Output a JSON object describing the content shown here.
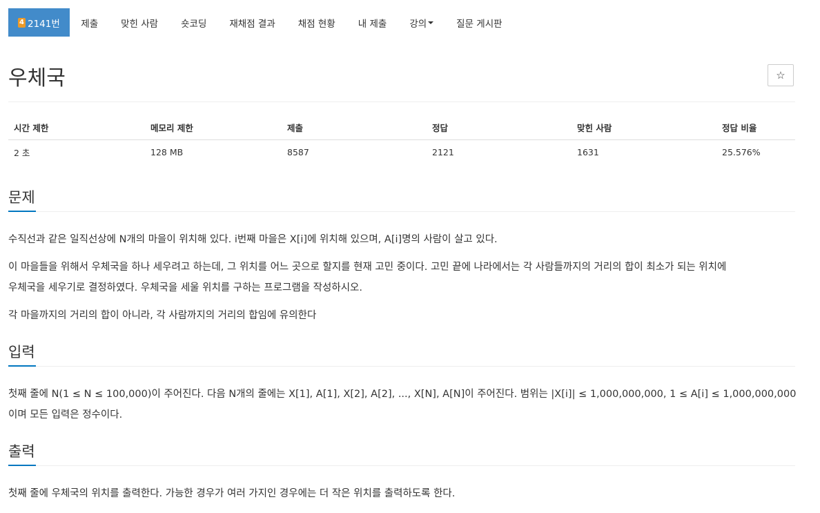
{
  "nav": {
    "problem_number": "2141번",
    "tier_badge": "4",
    "items": [
      {
        "label": "제출"
      },
      {
        "label": "맞힌 사람"
      },
      {
        "label": "숏코딩"
      },
      {
        "label": "재채점 결과"
      },
      {
        "label": "채점 현황"
      },
      {
        "label": "내 제출"
      },
      {
        "label": "강의"
      },
      {
        "label": "질문 게시판"
      }
    ]
  },
  "problem": {
    "title": "우체국",
    "star_icon": "☆"
  },
  "info_table": {
    "headers": [
      "시간 제한",
      "메모리 제한",
      "제출",
      "정답",
      "맞힌 사람",
      "정답 비율"
    ],
    "values": [
      "2 초",
      "128 MB",
      "8587",
      "2121",
      "1631",
      "25.576%"
    ]
  },
  "sections": {
    "problem_title": "문제",
    "problem_lines": [
      "수직선과 같은 일직선상에 N개의 마을이 위치해 있다. i번째 마을은 X[i]에 위치해 있으며, A[i]명의 사람이 살고 있다.",
      "이 마을들을 위해서 우체국을 하나 세우려고 하는데, 그 위치를 어느 곳으로 할지를 현재 고민 중이다. 고민 끝에 나라에서는 각 사람들까지의 거리의 합이 최소가 되는 위치에",
      "우체국을 세우기로 결정하였다. 우체국을 세울 위치를 구하는 프로그램을 작성하시오.",
      "각 마을까지의 거리의 합이 아니라, 각 사람까지의 거리의 합임에 유의한다"
    ],
    "input_title": "입력",
    "input_lines": [
      "첫째 줄에 N(1 ≤ N ≤ 100,000)이 주어진다. 다음 N개의 줄에는 X[1], A[1], X[2], A[2], ..., X[N], A[N]이 주어진다. 범위는 |X[i]| ≤ 1,000,000,000, 1 ≤ A[i] ≤ 1,000,000,000",
      "이며 모든 입력은 정수이다."
    ],
    "output_title": "출력",
    "output_lines": [
      "첫째 줄에 우체국의 위치를 출력한다. 가능한 경우가 여러 가지인 경우에는 더 작은 위치를 출력하도록 한다."
    ]
  },
  "colors": {
    "active_tab": "#428bca",
    "section_accent": "#0076c0",
    "tier_badge": "#ec9a29"
  }
}
